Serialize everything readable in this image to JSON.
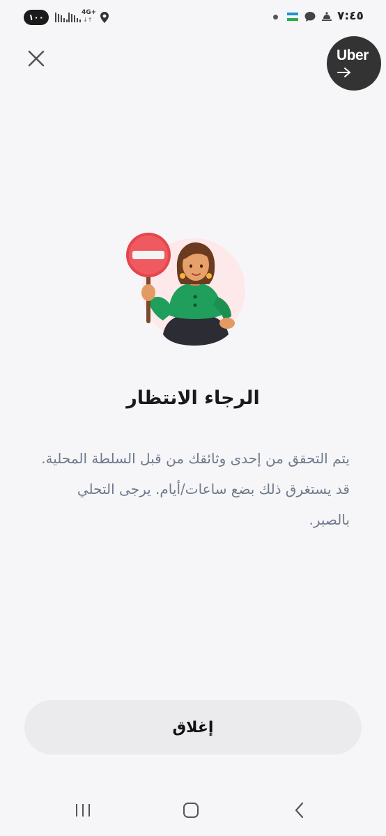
{
  "status_bar": {
    "battery": "١٠٠",
    "network": "4G+",
    "network_arrows": "↓↑",
    "time": "٧:٤٥"
  },
  "header": {
    "close_icon": "close-icon",
    "brand_label": "Uber",
    "brand_icon": "arrow-right-icon",
    "brand_color": "#333333"
  },
  "illustration": {
    "icon": "stop-sign-woman-illustration",
    "accent": "#e5464d",
    "background": "#fde8ea"
  },
  "main": {
    "title": "الرجاء الانتظار",
    "message": "يتم التحقق من إحدى وثائقك من قبل السلطة المحلية. قد يستغرق ذلك بضع ساعات/أيام. يرجى التحلي بالصبر."
  },
  "actions": {
    "close_label": "إغلاق"
  },
  "nav_bar": {
    "recent_icon": "recent-apps-icon",
    "home_icon": "home-icon",
    "back_icon": "back-icon"
  }
}
